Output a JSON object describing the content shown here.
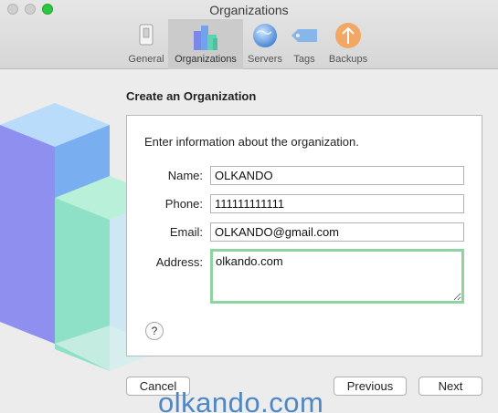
{
  "window": {
    "title": "Organizations"
  },
  "toolbar": {
    "items": [
      {
        "label": "General",
        "icon": "switch-icon"
      },
      {
        "label": "Organizations",
        "icon": "building-blocks-icon"
      },
      {
        "label": "Servers",
        "icon": "globe-icon"
      },
      {
        "label": "Tags",
        "icon": "tag-icon"
      },
      {
        "label": "Backups",
        "icon": "upload-arrow-icon"
      }
    ],
    "active": "Organizations"
  },
  "form": {
    "heading": "Create an Organization",
    "intro": "Enter information about the organization.",
    "name_label": "Name:",
    "name_value": "OLKANDO",
    "phone_label": "Phone:",
    "phone_value": "111111111111",
    "email_label": "Email:",
    "email_value": "OLKANDO@gmail.com",
    "address_label": "Address:",
    "address_value": "olkando.com",
    "help_label": "?"
  },
  "buttons": {
    "cancel": "Cancel",
    "previous": "Previous",
    "next": "Next"
  },
  "watermark": "olkando.com",
  "colors": {
    "accent_focus": "#8fd3a0",
    "zoom_button": "#2ac840",
    "watermark": "#4f86c6"
  }
}
